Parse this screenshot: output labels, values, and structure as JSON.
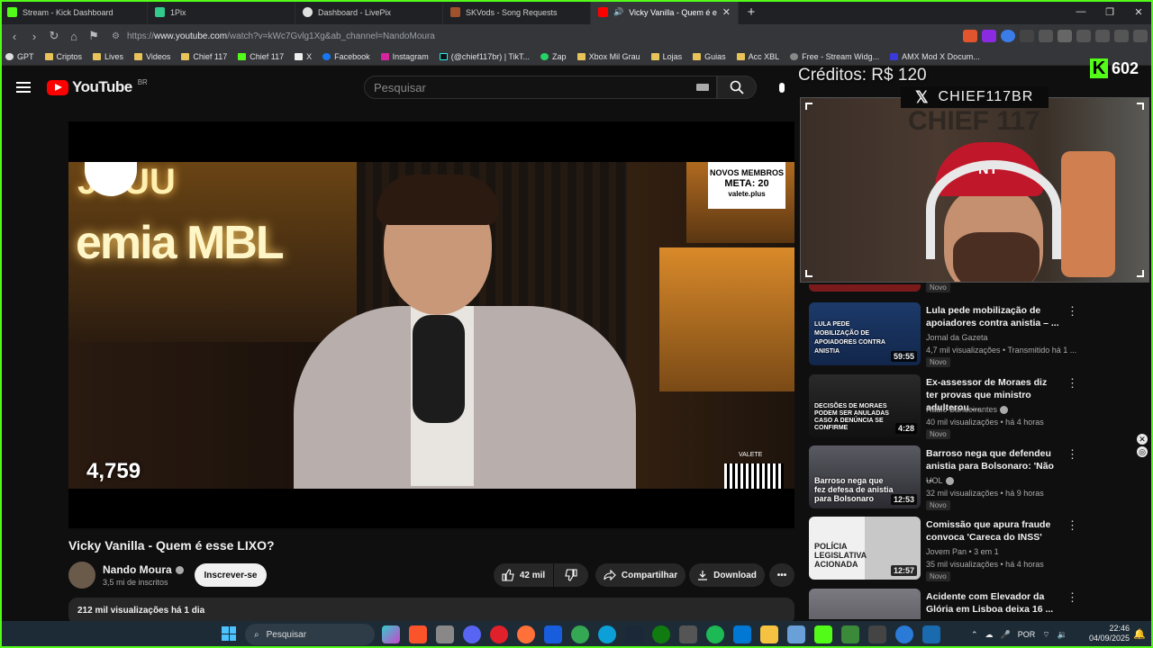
{
  "browser": {
    "tabs": [
      {
        "title": "Stream - Kick Dashboard",
        "color": "#53fc18"
      },
      {
        "title": "1Pix",
        "color": "#31c98c"
      },
      {
        "title": "Dashboard - LivePix",
        "color": "#e0e0e0"
      },
      {
        "title": "SKVods - Song Requests",
        "color": "#a0522d"
      },
      {
        "title": "Vicky Vanilla - Quem é esse LIXO?",
        "color": "#ff0000"
      }
    ],
    "url_prefix": "https://",
    "url_host": "www.youtube.com",
    "url_rest": "/watch?v=kWc7Gvlg1Xg&ab_channel=NandoMoura",
    "bookmarks": [
      "GPT",
      "Criptos",
      "Lives",
      "Videos",
      "Chief 117",
      "Chief 117",
      "X",
      "Facebook",
      "Instagram",
      "(@chief117br) | TikT...",
      "Zap",
      "Xbox Mil Grau",
      "Lojas",
      "Guias",
      "Acc XBL",
      "Free - Stream Widg...",
      "AMX Mod X Docum..."
    ]
  },
  "youtube": {
    "logo": "YouTube",
    "region": "BR",
    "search_placeholder": "Pesquisar",
    "video": {
      "title": "Vicky Vanilla - Quem é esse LIXO?",
      "overlay_counter": "4,759",
      "overlay_sign": "NOVOS MEMBROS",
      "overlay_meta": "META: 20",
      "overlay_site": "valete.plus",
      "overlay_wall_top": "JUUU",
      "overlay_wall": "emia MBL",
      "overlay_brand": "VALETE"
    },
    "channel": {
      "name": "Nando Moura",
      "subs": "3,5 mi de inscritos",
      "subscribe": "Inscrever-se"
    },
    "actions": {
      "likes": "42 mil",
      "share": "Compartilhar",
      "download": "Download"
    },
    "description": "212 mil visualizações  há 1 dia"
  },
  "overlay": {
    "credits": "Créditos: R$ 120",
    "kick_count": "602",
    "x_handle": "CHIEF117BR",
    "cap_logo": "NY",
    "wall_text": "CHIEF 117"
  },
  "sidebar": [
    {
      "title": "",
      "channel": "",
      "views": "",
      "novo": "Novo",
      "duration": "",
      "thumb_text": "",
      "thumb_color": "#7a1a1a",
      "verified": false
    },
    {
      "title": "Lula pede mobilização de apoiadores contra anistia – ...",
      "channel": "Jornal da Gazeta",
      "views": "4,7 mil visualizações • Transmitido há 1 ...",
      "novo": "Novo",
      "duration": "59:55",
      "thumb_text": "LULA PEDE MOBILIZAÇÃO DE APOIADORES CONTRA ANISTIA",
      "thumb_color": "#1c3a6a",
      "verified": false
    },
    {
      "title": "Ex-assessor de Moraes diz ter provas que ministro adulterou ...",
      "channel": "Rádio Bandeirantes",
      "views": "40 mil visualizações • há 4 horas",
      "novo": "Novo",
      "duration": "4:28",
      "thumb_text": "DECISÕES DE MORAES PODEM SER ANULADAS CASO A DENÚNCIA SE CONFIRME",
      "thumb_color": "#1a1a1a",
      "verified": true
    },
    {
      "title": "Barroso nega que defendeu anistia para Bolsonaro: 'Não ...",
      "channel": "UOL",
      "views": "32 mil visualizações • há 9 horas",
      "novo": "Novo",
      "duration": "12:53",
      "thumb_text": "Barroso nega que fez defesa de anistia para Bolsonaro",
      "thumb_color": "#4a4a52",
      "verified": true
    },
    {
      "title": "Comissão que apura fraude convoca 'Careca do INSS'",
      "channel": "Jovem Pan • 3 em 1",
      "views": "35 mil visualizações • há 4 horas",
      "novo": "Novo",
      "duration": "12:57",
      "thumb_text": "POLÍCIA LEGISLATIVA ACIONADA",
      "thumb_color": "#d8d8d8",
      "verified": false
    },
    {
      "title": "Acidente com Elevador da Glória em Lisboa deixa 16 ...",
      "channel": "",
      "views": "",
      "novo": "",
      "duration": "",
      "thumb_text": "",
      "thumb_color": "#6a6a70",
      "verified": false
    }
  ],
  "taskbar": {
    "search": "Pesquisar",
    "lang": "POR",
    "time": "22:46",
    "date": "04/09/2025"
  }
}
